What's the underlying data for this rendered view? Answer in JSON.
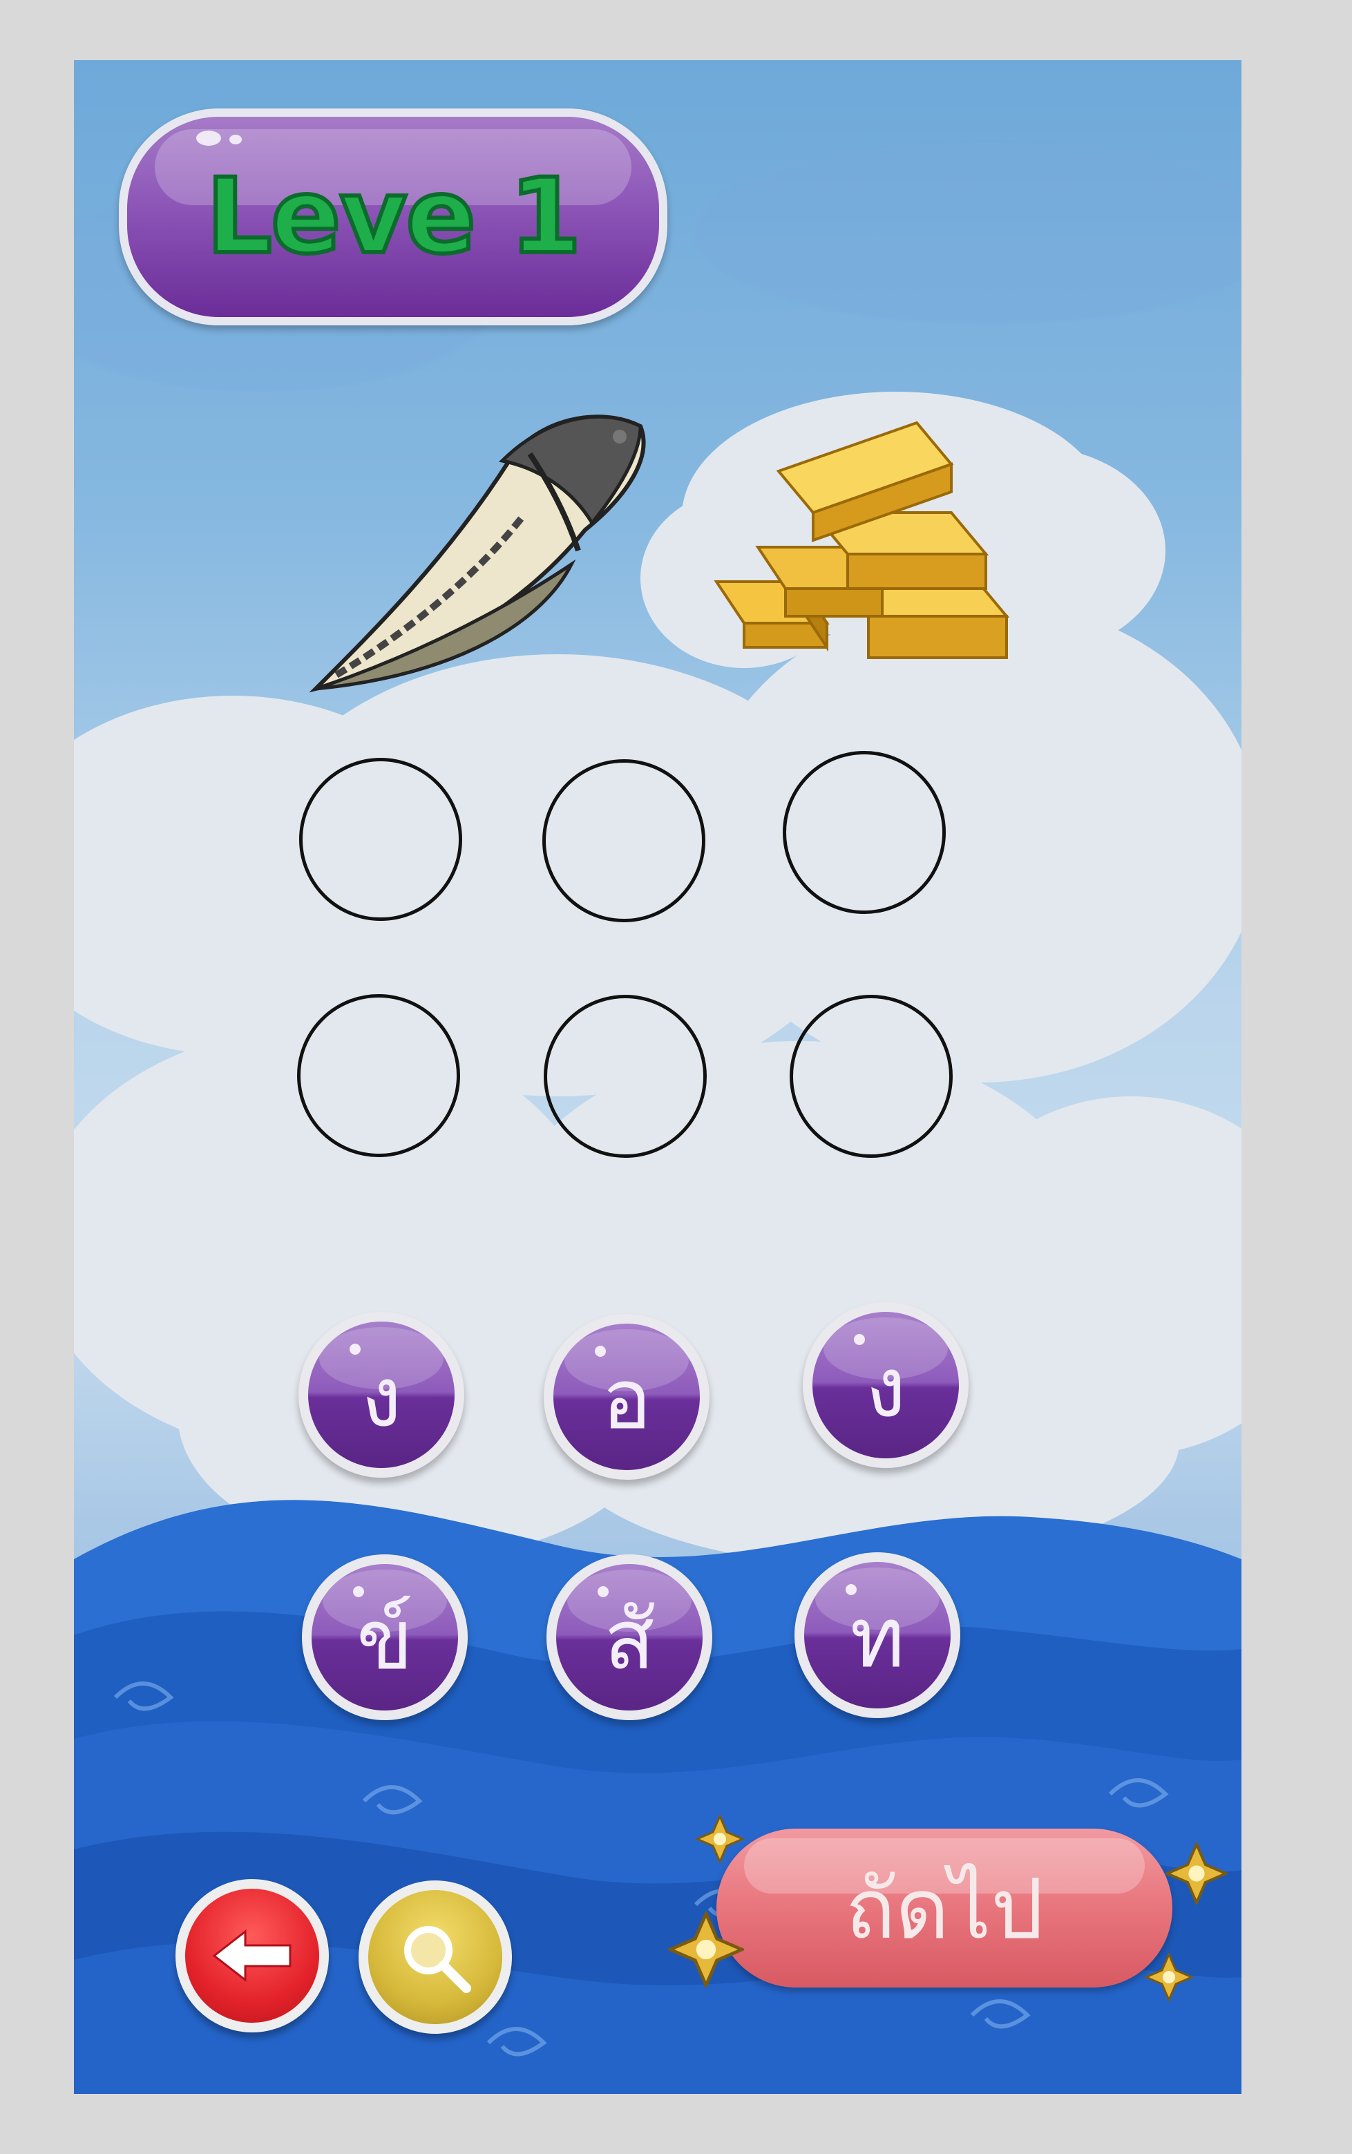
{
  "level": {
    "label": "Leve 1"
  },
  "clue_images": [
    {
      "icon": "conch-shell-icon"
    },
    {
      "icon": "gold-bars-icon"
    }
  ],
  "answer_slots": [
    "",
    "",
    "",
    "",
    "",
    ""
  ],
  "letter_tiles": [
    "ง",
    "อ",
    "ง",
    "ข์",
    "สั",
    "ท"
  ],
  "controls": {
    "back_icon": "arrow-left-icon",
    "hint_icon": "magnifier-icon",
    "next_label": "ถัดไป"
  },
  "colors": {
    "tile_purple": "#8e5bbb",
    "level_text_green": "#1eae4a",
    "next_pink": "#e8757d",
    "back_red": "#e4232b",
    "hint_yellow": "#d6b93a",
    "sea_blue": "#1f63c9"
  }
}
